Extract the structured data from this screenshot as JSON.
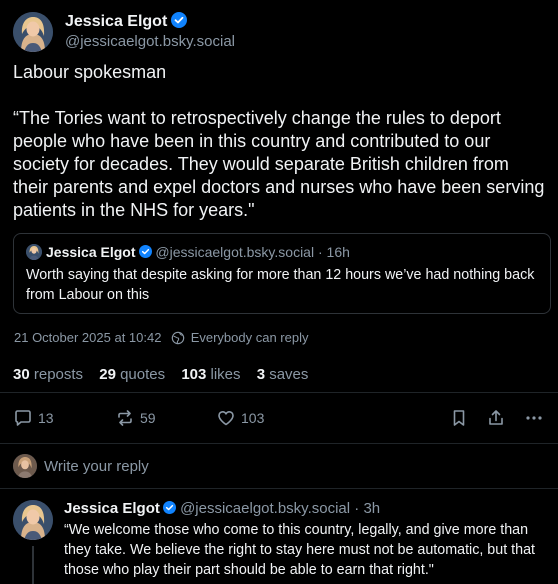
{
  "post": {
    "author_name": "Jessica Elgot",
    "author_handle": "@jessicaelgot.bsky.social",
    "text_lines": [
      "Labour spokesman",
      "",
      "“The Tories want to retrospectively change the rules to deport people who have been in this country and contributed to our society for decades. They would separate British children from their parents and expel doctors and nurses who have been serving patients in the NHS for years.\""
    ],
    "timestamp": "21 October 2025 at 10:42",
    "visibility": "Everybody can reply"
  },
  "quote": {
    "author_name": "Jessica Elgot",
    "author_handle": "@jessicaelgot.bsky.social",
    "dot": "·",
    "time": "16h",
    "text": "Worth saying that despite asking for more than 12 hours we’ve had nothing back from Labour on this"
  },
  "stats": {
    "reposts_count": "30",
    "reposts_label": "reposts",
    "quotes_count": "29",
    "quotes_label": "quotes",
    "likes_count": "103",
    "likes_label": "likes",
    "saves_count": "3",
    "saves_label": "saves"
  },
  "actions": {
    "reply_count": "13",
    "repost_count": "59",
    "like_count": "103",
    "icons": [
      "reply-icon",
      "repost-icon",
      "like-icon",
      "bookmark-icon",
      "share-icon",
      "more-icon"
    ]
  },
  "reply_bar": {
    "placeholder": "Write your reply"
  },
  "reply": {
    "author_name": "Jessica Elgot",
    "author_handle": "@jessicaelgot.bsky.social",
    "dot": "·",
    "time": "3h",
    "text": "“We welcome those who come to this country, legally, and give more than they take. We believe the right to stay here must not be automatic, but that those who play their part should be able to earn that right.\""
  },
  "colors": {
    "background": "#000000",
    "text": "#f1f3f5",
    "muted": "#8b98a5",
    "verified": "#1083fe",
    "border": "#2e3338"
  }
}
